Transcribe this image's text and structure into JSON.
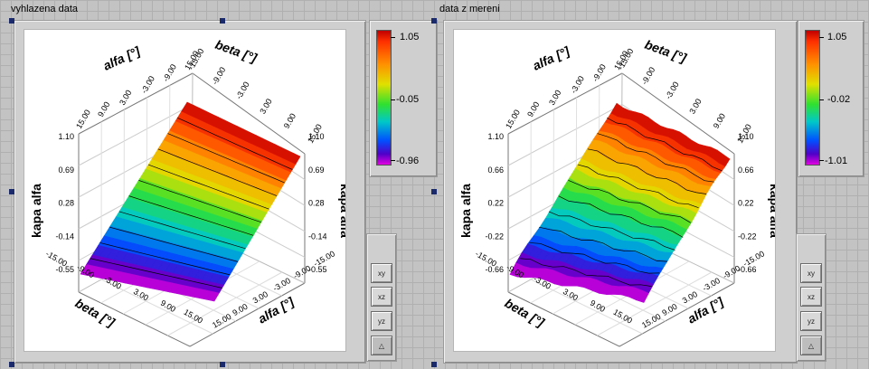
{
  "graphs": [
    {
      "title": "vyhlazena data",
      "y_axis": {
        "label": "kapa alfa",
        "ticks": [
          "1.10",
          "0.69",
          "0.28",
          "-0.14",
          "-0.55"
        ]
      },
      "right_axis": {
        "label": "kapa alfa",
        "ticks": [
          "1.10",
          "0.69",
          "0.28",
          "-0.14",
          "-0.55"
        ]
      },
      "beta_axis": {
        "label": "beta",
        "unit": "[°]",
        "ticks": [
          "-15.00",
          "-9.00",
          "-3.00",
          "3.00",
          "9.00",
          "15.00"
        ]
      },
      "alfa_axis": {
        "label": "alfa",
        "unit": "[°]",
        "ticks": [
          "-15.00",
          "-9.00",
          "-3.00",
          "3.00",
          "9.00",
          "15.00"
        ]
      },
      "top_beta_ticks": [
        "-15.00",
        "-9.00",
        "-3.00",
        "3.00",
        "9.00",
        "15.00"
      ],
      "top_alfa_ticks": [
        "15.00",
        "9.00",
        "3.00",
        "-3.00",
        "-9.00",
        "15.00"
      ],
      "colorbar": {
        "max": "1.05",
        "mid": "-0.05",
        "min": "-0.96"
      }
    },
    {
      "title": "data z mereni",
      "y_axis": {
        "label": "kapa alfa",
        "ticks": [
          "1.10",
          "0.66",
          "0.22",
          "-0.22",
          "-0.66"
        ]
      },
      "right_axis": {
        "label": "kapa alfa",
        "ticks": [
          "1.10",
          "0.66",
          "0.22",
          "-0.22",
          "-0.66"
        ]
      },
      "beta_axis": {
        "label": "beta",
        "unit": "[°]",
        "ticks": [
          "-15.00",
          "-9.00",
          "-3.00",
          "3.00",
          "9.00",
          "15.00"
        ]
      },
      "alfa_axis": {
        "label": "alfa",
        "unit": "[°]",
        "ticks": [
          "-15.00",
          "-9.00",
          "-3.00",
          "3.00",
          "9.00",
          "15.00"
        ]
      },
      "top_beta_ticks": [
        "-15.00",
        "-9.00",
        "-3.00",
        "3.00",
        "9.00",
        "15.00"
      ],
      "top_alfa_ticks": [
        "15.00",
        "9.00",
        "3.00",
        "-3.00",
        "-9.00",
        "15.00"
      ],
      "colorbar": {
        "max": "1.05",
        "mid": "-0.02",
        "min": "-1.01"
      }
    }
  ],
  "view_buttons": [
    "view-xy-icon",
    "view-xz-icon",
    "view-yz-icon",
    "view-default-icon"
  ]
}
